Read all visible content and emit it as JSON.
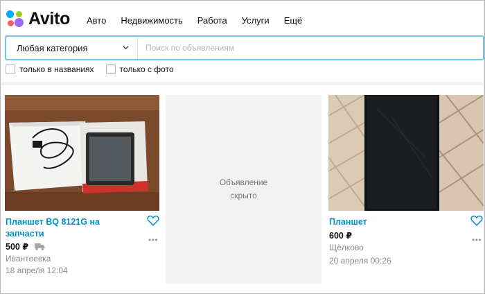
{
  "header": {
    "logo_text": "Avito",
    "nav": [
      "Авто",
      "Недвижимость",
      "Работа",
      "Услуги",
      "Ещё"
    ]
  },
  "search": {
    "category": "Любая категория",
    "placeholder": "Поиск по объявлениям"
  },
  "filters": {
    "titles_only": "только в названиях",
    "with_photo": "только с фото"
  },
  "listings": [
    {
      "title": "Планшет BQ 8121G на запчасти",
      "price": "500 ₽",
      "location": "Ивантеевка",
      "date": "18 апреля 12:04"
    },
    {
      "hidden_text": "Объявление\nскрыто"
    },
    {
      "title": "Планшет",
      "price": "600 ₽",
      "location": "Щёлково",
      "date": "20 апреля 00:26"
    }
  ],
  "icons": {
    "favorite": "heart-outline-icon",
    "more": "more-dots-icon",
    "delivery": "truck-icon",
    "dropdown": "chevron-down-icon"
  },
  "colors": {
    "link": "#0091d1",
    "search_border": "#72c6e8",
    "logo_blue": "#00aaff",
    "logo_green": "#97cf26",
    "logo_purple": "#a169f7",
    "logo_red": "#ff6163"
  }
}
